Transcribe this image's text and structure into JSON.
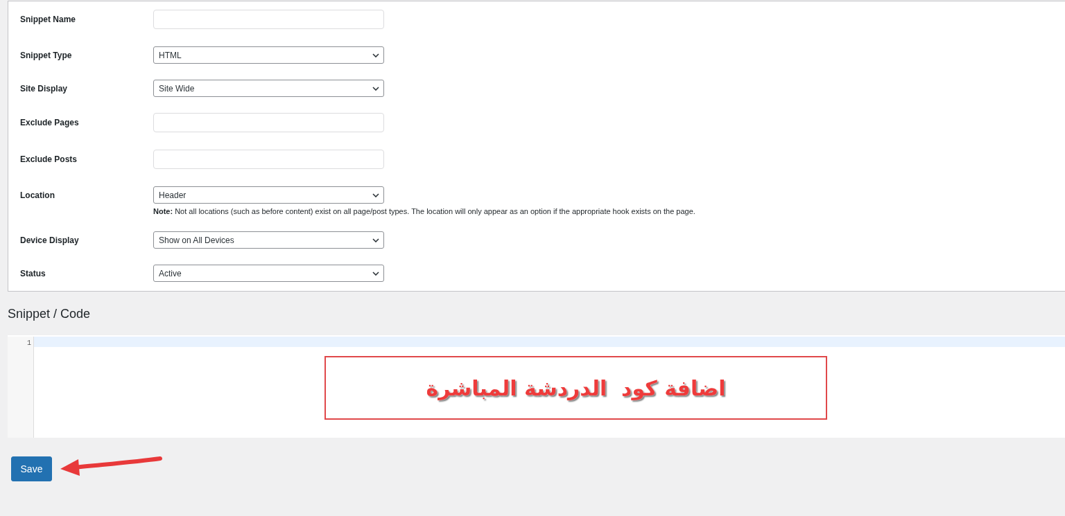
{
  "form": {
    "fields": [
      {
        "label": "Snippet Name",
        "kind": "text"
      },
      {
        "label": "Snippet Type",
        "kind": "select",
        "value": "HTML"
      },
      {
        "label": "Site Display",
        "kind": "select",
        "value": "Site Wide"
      },
      {
        "label": "Exclude Pages",
        "kind": "text"
      },
      {
        "label": "Exclude Posts",
        "kind": "text"
      },
      {
        "label": "Location",
        "kind": "select",
        "value": "Header",
        "note": "**Note:** Not all locations (such as before content) exist on all page/post types. The location will only appear as an option if the appropriate hook exists on the page."
      },
      {
        "label": "Device Display",
        "kind": "select",
        "value": "Show on All Devices"
      },
      {
        "label": "Status",
        "kind": "select",
        "value": "Active"
      }
    ]
  },
  "code_section": {
    "heading": "Snippet / Code",
    "line_numbers": [
      "1"
    ],
    "annotation": "اضافة كود  الدردشة المباشرة"
  },
  "buttons": [
    {
      "label": "Save"
    }
  ]
}
